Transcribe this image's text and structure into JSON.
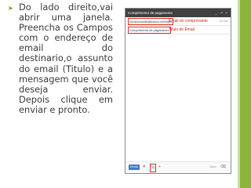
{
  "slide": {
    "bullet": "Do lado direito,vai abrir uma janela. Preencha os Campos com o endereço de email do destinario,o assunto do email (Titulo) e a mensagem que você deseja enviar. Depois clique em enviar e pronto."
  },
  "compose": {
    "header_title": "Comprimento de pagamento",
    "to_value": "comprovante@banco.exemplo",
    "to_annotation": "Email do comprovante",
    "cc_label": "Cc Cco",
    "subject_value": "Comprimento de pagamento",
    "subject_annotation": "Titulo do Email",
    "send_label": "Enviar",
    "right_label": "Salvo"
  },
  "icons": {
    "bullet": "arrow-bullet-icon",
    "minimize": "minimize-icon",
    "expand": "expand-icon",
    "close": "close-icon",
    "format": "format-text-icon",
    "attach": "paperclip-icon",
    "insert": "plus-icon",
    "trash": "trash-icon"
  },
  "colors": {
    "accent_green": "#8cb33a",
    "annotation_red": "#e03020",
    "send_blue": "#4a78c8"
  }
}
